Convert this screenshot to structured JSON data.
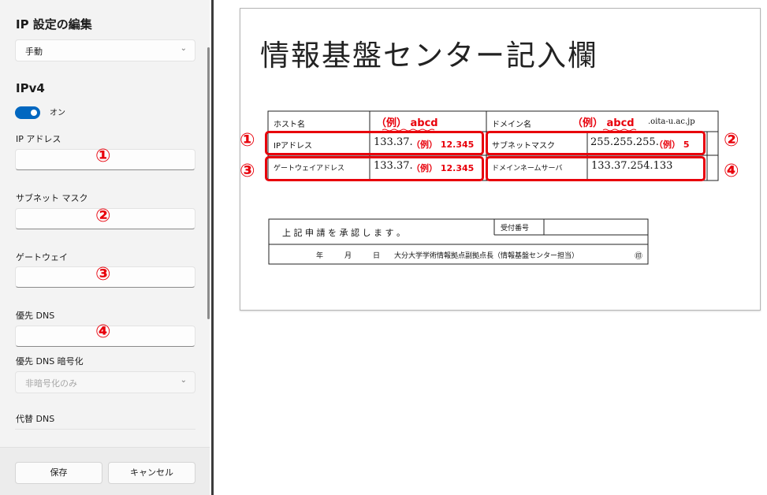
{
  "panel": {
    "title": "IP 設定の編集",
    "mode_value": "手動",
    "section": "IPv4",
    "toggle_label": "オン",
    "fields": [
      {
        "label": "IP アドレス",
        "badge": "①"
      },
      {
        "label": "サブネット マスク",
        "badge": "②"
      },
      {
        "label": "ゲートウェイ",
        "badge": "③"
      },
      {
        "label": "優先 DNS",
        "badge": "④"
      }
    ],
    "dns_encryption_label": "優先 DNS 暗号化",
    "dns_encryption_value": "非暗号化のみ",
    "alt_dns_label": "代替 DNS",
    "save": "保存",
    "cancel": "キャンセル"
  },
  "form": {
    "title": "情報基盤センター記入欄",
    "host_label": "ホスト名",
    "host_example": "（例） abcd",
    "domain_label": "ドメイン名",
    "domain_example": "（例） abcd",
    "domain_suffix": ".oita-u.ac.jp",
    "ip_label": "IPアドレス",
    "ip_prefix": "133.37.",
    "ip_example": "（例） 12.345",
    "subnet_label": "サブネットマスク",
    "subnet_prefix": "255.255.255.",
    "subnet_example": "（例） 5",
    "gateway_label": "ゲートウェイアドレス",
    "gateway_prefix": "133.37.",
    "gateway_example": "（例） 12.345",
    "dns_label": "ドメインネームサーバ",
    "dns_value": "133.37.254.133",
    "approval_text": "上 記 申 請 を 承 認 し ま す 。",
    "receipt_label": "受付番号",
    "date_line": "年　　　月　　　日　　大分大学学術情報拠点副拠点長（情報基盤センター担当）",
    "seal": "㊞",
    "badges": [
      "①",
      "②",
      "③",
      "④"
    ]
  }
}
